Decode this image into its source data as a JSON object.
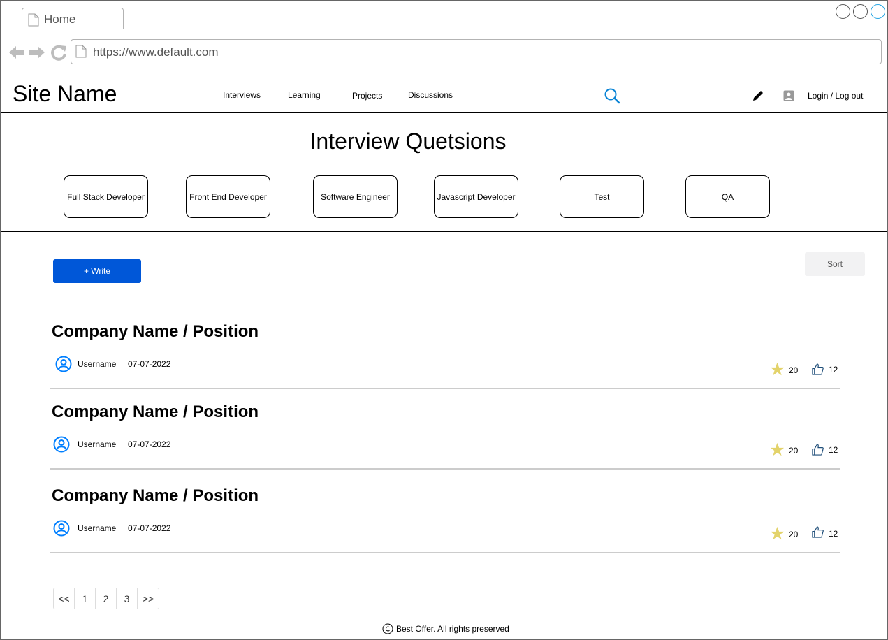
{
  "browser": {
    "tab_label": "Home",
    "url": "https://www.default.com"
  },
  "header": {
    "site_name": "Site Name",
    "nav": [
      "Interviews",
      "Learning",
      "Projects",
      "Discussions"
    ],
    "search_placeholder": "",
    "login_label": "Login / Log out"
  },
  "categories": {
    "title": "Interview Quetsions",
    "items": [
      "Full Stack Developer",
      "Front End Developer",
      "Software Engineer",
      "Javascript Developer",
      "Test",
      "QA"
    ]
  },
  "toolbar": {
    "write_label": "+ Write",
    "sort_label": "Sort"
  },
  "posts": [
    {
      "title": "Company Name / Position",
      "username": "Username",
      "date": "07-07-2022",
      "stars": "20",
      "likes": "12"
    },
    {
      "title": "Company Name / Position",
      "username": "Username",
      "date": "07-07-2022",
      "stars": "20",
      "likes": "12"
    },
    {
      "title": "Company Name / Position",
      "username": "Username",
      "date": "07-07-2022",
      "stars": "20",
      "likes": "12"
    }
  ],
  "pagination": [
    "<<",
    "1",
    "2",
    "3",
    ">>"
  ],
  "footer": {
    "text": "Best Offer. All rights preserved"
  },
  "colors": {
    "primary": "#0057d8",
    "star": "#e3d36b",
    "icon_blue": "#007fff",
    "divider": "#cccccc"
  }
}
